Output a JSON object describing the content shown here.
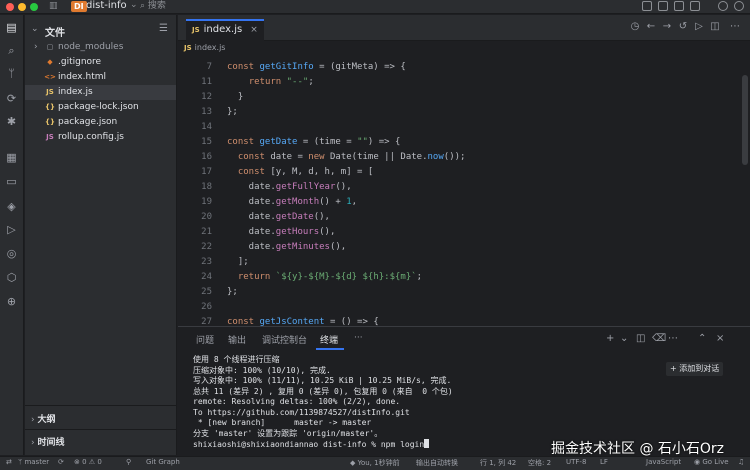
{
  "titlebar": {
    "app_badge": "DI",
    "project": "dist-info",
    "chevron": "⌄",
    "search_placeholder": "搜索"
  },
  "activity_icons": [
    "files-icon",
    "search-icon",
    "git-branch-icon",
    "source-icon",
    "debug-icon",
    "grid-icon",
    "folder-icon",
    "git-icon",
    "run-icon",
    "deploy-icon",
    "package-icon",
    "dependency-icon",
    "terminal-icon"
  ],
  "sidebar": {
    "title": "文件",
    "outline": "大纲",
    "timeline": "时间线",
    "tree": [
      {
        "icon": "▢",
        "label": "node_modules",
        "color": "#9da0a8",
        "kind": "folder"
      },
      {
        "icon": "◆",
        "label": ".gitignore",
        "color": "#e07a2f",
        "kind": "file"
      },
      {
        "icon": "<>",
        "label": "index.html",
        "color": "#e07a2f",
        "kind": "file"
      },
      {
        "icon": "JS",
        "label": "index.js",
        "color": "#e8c46a",
        "kind": "file",
        "selected": true
      },
      {
        "icon": "{}",
        "label": "package-lock.json",
        "color": "#e8c46a",
        "kind": "file"
      },
      {
        "icon": "{}",
        "label": "package.json",
        "color": "#e8c46a",
        "kind": "file"
      },
      {
        "icon": "JS",
        "label": "rollup.config.js",
        "color": "#c77dbb",
        "kind": "file"
      }
    ]
  },
  "editor": {
    "tab": {
      "icon": "JS",
      "label": "index.js",
      "close": "×"
    },
    "breadcrumb": {
      "icon": "JS",
      "label": "index.js"
    },
    "lines": [
      {
        "n": "7",
        "html": "<span class='k'>const</span> <span class='f'>getGitInfo</span> = (gitMeta) => {"
      },
      {
        "n": "11",
        "html": "    <span class='k'>return</span> <span class='s'>\"--\"</span>;"
      },
      {
        "n": "12",
        "html": "  }"
      },
      {
        "n": "13",
        "html": "};"
      },
      {
        "n": "14",
        "html": ""
      },
      {
        "n": "15",
        "html": "<span class='k'>const</span> <span class='f'>getDate</span> = (time = <span class='s'>\"\"</span>) => {"
      },
      {
        "n": "16",
        "html": "  <span class='k'>const</span> date = <span class='k'>new</span> Date(time || Date.<span class='f'>now</span>());"
      },
      {
        "n": "17",
        "html": "  <span class='k'>const</span> [y, M, d, h, m] = ["
      },
      {
        "n": "18",
        "html": "    date.<span class='p'>getFullYear</span>(),"
      },
      {
        "n": "19",
        "html": "    date.<span class='p'>getMonth</span>() + <span class='n'>1</span>,"
      },
      {
        "n": "20",
        "html": "    date.<span class='p'>getDate</span>(),"
      },
      {
        "n": "21",
        "html": "    date.<span class='p'>getHours</span>(),"
      },
      {
        "n": "22",
        "html": "    date.<span class='p'>getMinutes</span>(),"
      },
      {
        "n": "23",
        "html": "  ];"
      },
      {
        "n": "24",
        "html": "  <span class='k'>return</span> <span class='s'>`${y}-${M}-${d} ${h}:${m}`</span>;"
      },
      {
        "n": "25",
        "html": "};"
      },
      {
        "n": "26",
        "html": ""
      },
      {
        "n": "27",
        "html": "<span class='k'>const</span> <span class='f'>getJsContent</span> = () => {"
      }
    ]
  },
  "panel": {
    "tabs": [
      "问题",
      "输出",
      "调试控制台",
      "终端",
      "···"
    ],
    "active_tab": "终端",
    "add_chat": "+ 添加到对话",
    "terminal": [
      "使用 8 个线程进行压缩",
      "压缩对象中: 100% (10/10), 完成.",
      "写入对象中: 100% (11/11), 10.25 KiB | 10.25 MiB/s, 完成.",
      "总共 11 (差异 2) , 复用 0 (差异 0), 包复用 0 (来自  0 个包)",
      "remote: Resolving deltas: 100% (2/2), done.",
      "To https://github.com/1139874527/distInfo.git",
      " * [new branch]      master -> master",
      "分支 'master' 设置为跟踪 'origin/master'。",
      "shixiaoshi@shixiaondiannao dist-info % npm login"
    ]
  },
  "statusbar": {
    "branch": "master",
    "errors": "0",
    "warnings": "0",
    "graph": "Git Graph",
    "position": "You, 1秒钟前",
    "cursor": "行 1, 列 42",
    "spaces": "空格: 2",
    "encoding": "UTF-8",
    "eol": "LF",
    "autosave": "输出自动转换",
    "language": "JavaScript",
    "golive": "Go Live"
  },
  "watermark": "掘金技术社区 @ 石小石Orz"
}
